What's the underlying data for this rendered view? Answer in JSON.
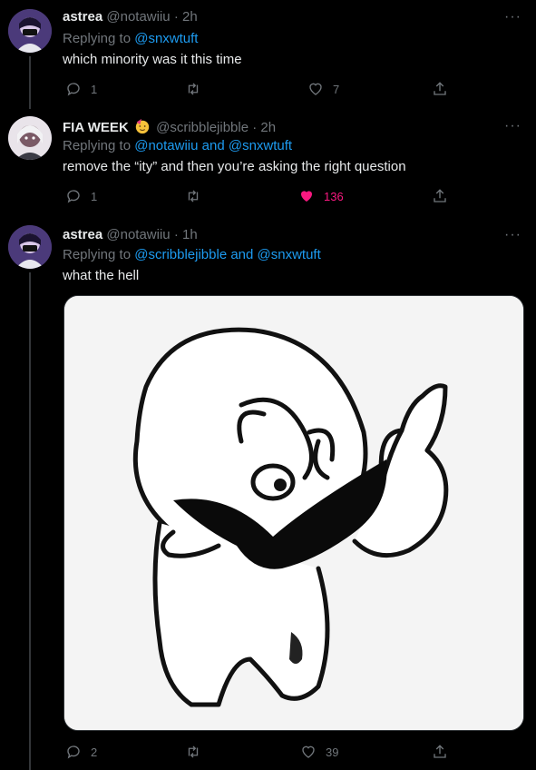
{
  "tweets": [
    {
      "name": "astrea",
      "handle": "@notawiiu",
      "time": "2h",
      "replying_prefix": "Replying to ",
      "replying_to": "@snxwtuft",
      "text": "which minority was it this time",
      "counts": {
        "reply": "1",
        "retweet": "",
        "like": "7"
      },
      "liked": false
    },
    {
      "name": "FIA WEEK",
      "emoji": "party-face-emoji",
      "handle": "@scribblejibble",
      "time": "2h",
      "replying_prefix": "Replying to ",
      "replying_to": "@notawiiu and @snxwtuft",
      "text": "remove the “ity” and then you’re asking the right question",
      "counts": {
        "reply": "1",
        "retweet": "",
        "like": "136"
      },
      "liked": true
    },
    {
      "name": "astrea",
      "handle": "@notawiiu",
      "time": "1h",
      "replying_prefix": "Replying to ",
      "replying_to": "@scribblejibble and @snxwtuft",
      "text": "what the hell",
      "media": "meme-drawing",
      "counts": {
        "reply": "2",
        "retweet": "",
        "like": "39"
      },
      "liked": false
    }
  ],
  "ui": {
    "more": "···",
    "dot": "·"
  },
  "colors": {
    "accent": "#1d9bf0",
    "like": "#f91880",
    "muted": "#71767b",
    "bg": "#000000"
  }
}
